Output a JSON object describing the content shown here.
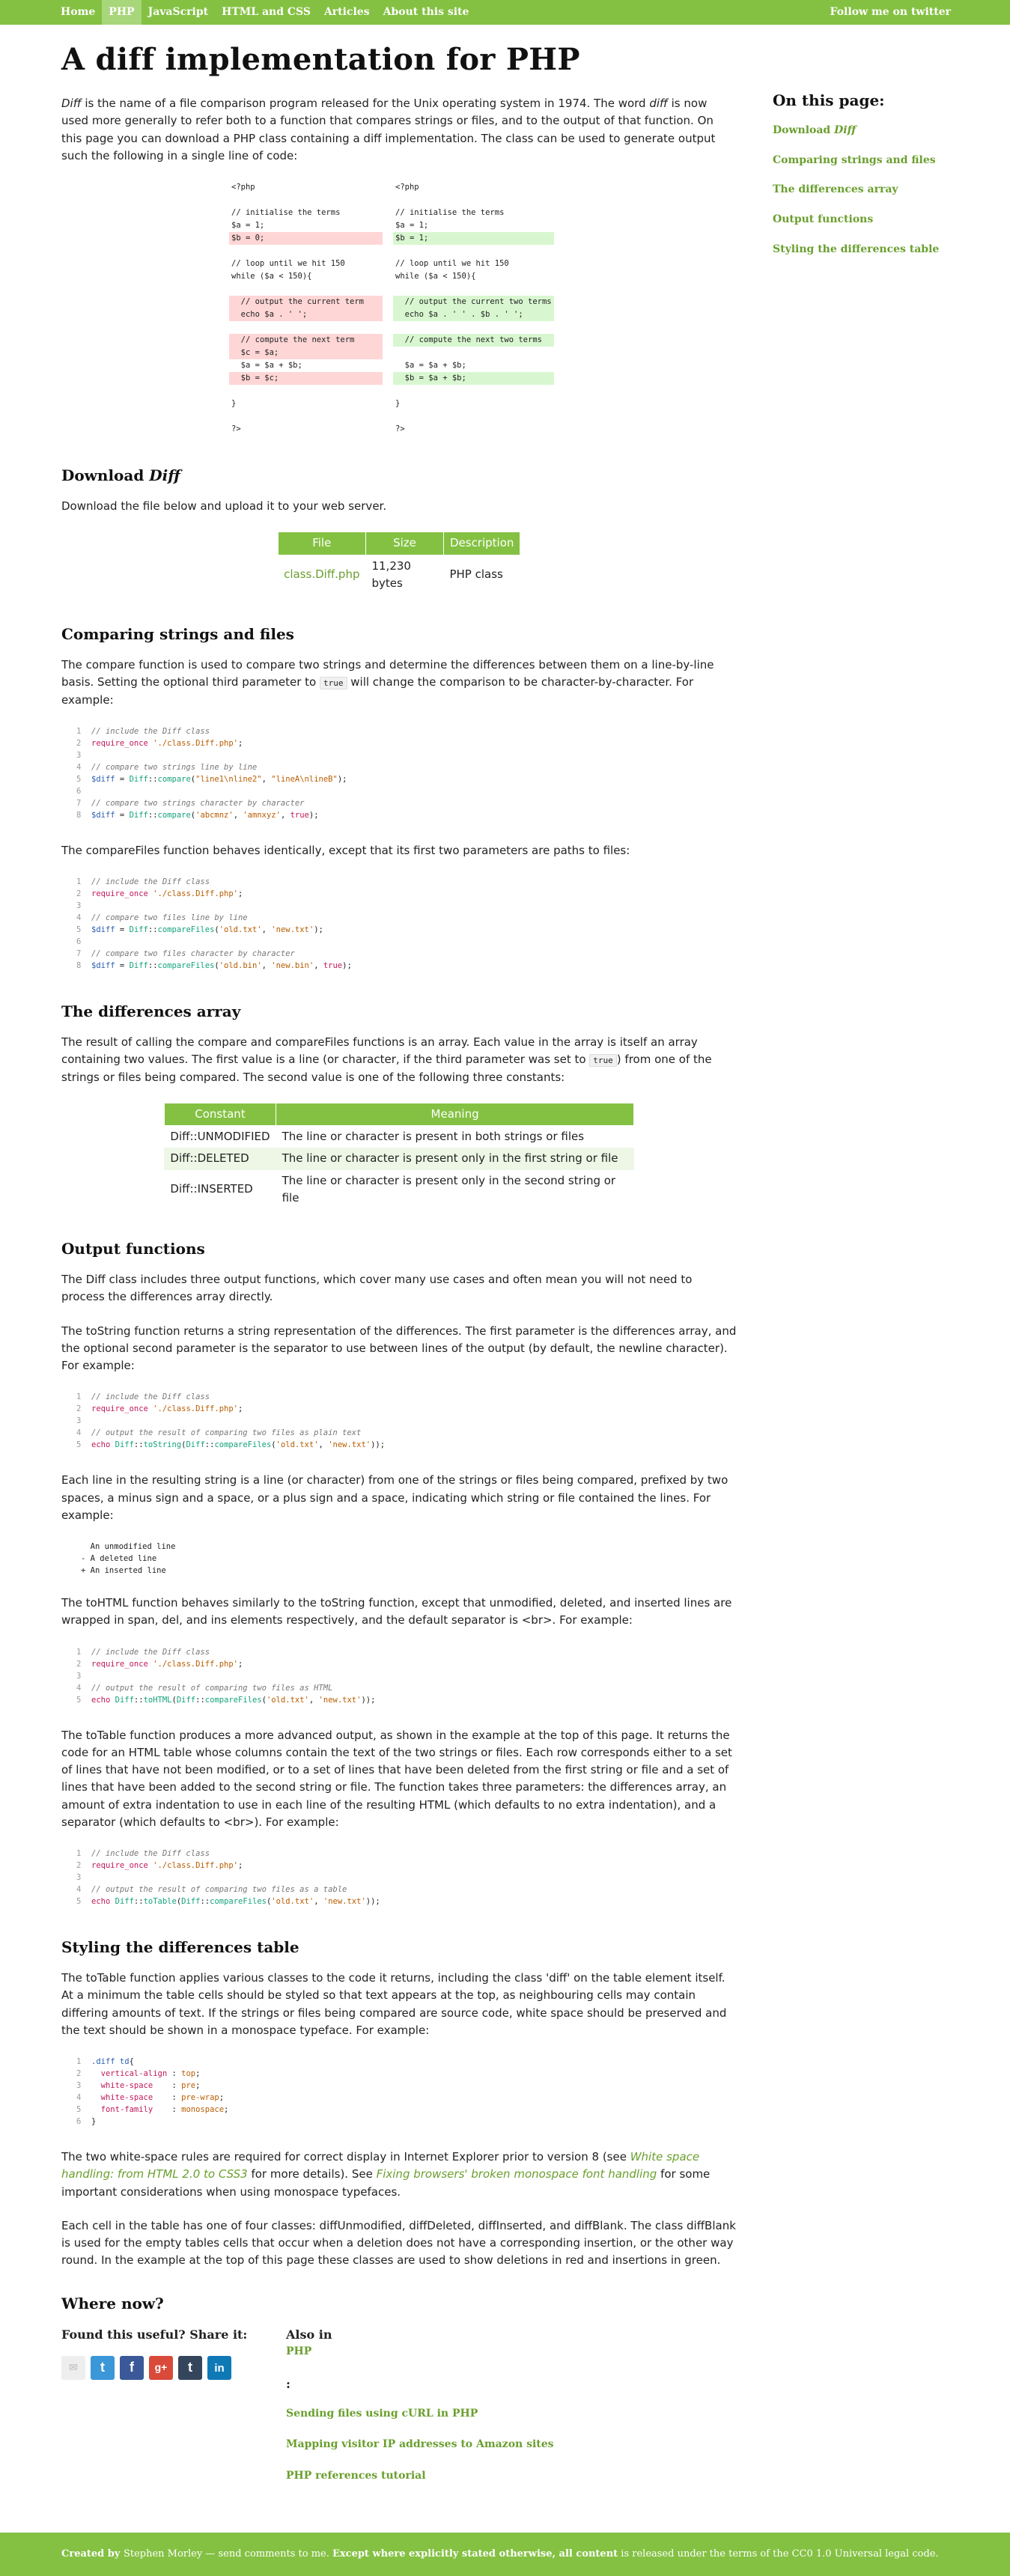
{
  "nav": {
    "items": [
      "Home",
      "PHP",
      "JavaScript",
      "HTML and CSS",
      "Articles",
      "About this site"
    ],
    "follow": "Follow me on twitter"
  },
  "title": "A diff implementation for PHP",
  "intro": {
    "em": "Diff",
    "t1": " is the name of a file comparison program released for the Unix operating system in 1974. The word ",
    "em2": "diff",
    "t2": " is now used more generally to refer both to a function that compares strings or files, and to the output of that function. On this page you can download a PHP class containing a diff implementation. The class can be used to generate output such the following in a single line of code:"
  },
  "diff_demo": [
    [
      "<?php",
      "",
      "<?php",
      ""
    ],
    [
      "",
      "",
      "",
      ""
    ],
    [
      "// initialise the terms",
      "",
      "// initialise the terms",
      ""
    ],
    [
      "$a = 1;",
      "",
      "$a = 1;",
      ""
    ],
    [
      "$b = 0;",
      "del",
      "$b = 1;",
      "ins"
    ],
    [
      "",
      "",
      "",
      ""
    ],
    [
      "// loop until we hit 150",
      "",
      "// loop until we hit 150",
      ""
    ],
    [
      "while ($a < 150){",
      "",
      "while ($a < 150){",
      ""
    ],
    [
      "",
      "",
      "",
      ""
    ],
    [
      "  // output the current term",
      "del",
      "  // output the current two terms",
      "ins"
    ],
    [
      "  echo $a . ' ';",
      "del",
      "  echo $a . ' ' . $b . ' ';",
      "ins"
    ],
    [
      "",
      "",
      "",
      ""
    ],
    [
      "  // compute the next term",
      "del",
      "  // compute the next two terms",
      "ins"
    ],
    [
      "  $c = $a;",
      "del",
      "",
      ""
    ],
    [
      "  $a = $a + $b;",
      "",
      "  $a = $a + $b;",
      ""
    ],
    [
      "  $b = $c;",
      "del",
      "  $b = $a + $b;",
      "ins"
    ],
    [
      "",
      "",
      "",
      ""
    ],
    [
      "}",
      "",
      "}",
      ""
    ],
    [
      "",
      "",
      "",
      ""
    ],
    [
      "?>",
      "",
      "?>",
      ""
    ]
  ],
  "toc": {
    "title": "On this page:",
    "items": [
      "Download ",
      "Comparing strings and files",
      "The differences array",
      "Output functions",
      "Styling the differences table"
    ],
    "first_em": "Diff"
  },
  "download": {
    "heading": "Download ",
    "heading_em": "Diff",
    "text": "Download the file below and upload it to your web server.",
    "headers": [
      "File",
      "Size",
      "Description"
    ],
    "row": [
      "class.Diff.php",
      "11,230 bytes",
      "PHP class"
    ]
  },
  "compare": {
    "heading": "Comparing strings and files",
    "p1a": "The compare function is used to compare two strings and determine the differences between them on a line-by-line basis. Setting the optional third parameter to ",
    "p1code": "true",
    "p1b": " will change the comparison to be character-by-character. For example:",
    "p2": "The compareFiles function behaves identically, except that its first two parameters are paths to files:"
  },
  "array": {
    "heading": "The differences array",
    "pa": "The result of calling the compare and compareFiles functions is an array. Each value in the array is itself an array containing two values. The first value is a line (or character, if the third parameter was set to ",
    "pcode": "true",
    "pb": ") from one of the strings or files being compared. The second value is one of the following three constants:",
    "headers": [
      "Constant",
      "Meaning"
    ],
    "rows": [
      [
        "Diff::UNMODIFIED",
        "The line or character is present in both strings or files"
      ],
      [
        "Diff::DELETED",
        "The line or character is present only in the first string or file"
      ],
      [
        "Diff::INSERTED",
        "The line or character is present only in the second string or file"
      ]
    ]
  },
  "output": {
    "heading": "Output functions",
    "p1": "The Diff class includes three output functions, which cover many use cases and often mean you will not need to process the differences array directly.",
    "p2": "The toString function returns a string representation of the differences. The first parameter is the differences array, and the optional second parameter is the separator to use between lines of the output (by default, the newline character). For example:",
    "p3": "Each line in the resulting string is a line (or character) from one of the strings or files being compared, prefixed by two spaces, a minus sign and a space, or a plus sign and a space, indicating which string or file contained the lines. For example:",
    "sample": "  An unmodified line\n- A deleted line\n+ An inserted line",
    "p4": "The toHTML function behaves similarly to the toString function, except that unmodified, deleted, and inserted lines are wrapped in span, del, and ins elements respectively, and the default separator is <br>. For example:",
    "p5": "The toTable function produces a more advanced output, as shown in the example at the top of this page. It returns the code for an HTML table whose columns contain the text of the two strings or files. Each row corresponds either to a set of lines that have not been modified, or to a set of lines that have been deleted from the first string or file and a set of lines that have been added to the second string or file. The function takes three parameters: the differences array, an amount of extra indentation to use in each line of the resulting HTML (which defaults to no extra indentation), and a separator (which defaults to <br>). For example:"
  },
  "styling": {
    "heading": "Styling the differences table",
    "p1": "The toTable function applies various classes to the code it returns, including the class 'diff' on the table element itself. At a minimum the table cells should be styled so that text appears at the top, as neighbouring cells may contain differing amounts of text. If the strings or files being compared are source code, white space should be preserved and the text should be shown in a monospace typeface. For example:",
    "p2a": "The two white-space rules are required for correct display in Internet Explorer prior to version 8 (see ",
    "p2link1": "White space handling: from HTML 2.0 to CSS3",
    "p2b": " for more details). See ",
    "p2link2": "Fixing browsers' broken monospace font handling",
    "p2c": " for some important considerations when using monospace typefaces.",
    "p3": "Each cell in the table has one of four classes: diffUnmodified, diffDeleted, diffInserted, and diffBlank. The class diffBlank is used for the empty tables cells that occur when a deletion does not have a corresponding insertion, or the other way round. In the example at the top of this page these classes are used to show deletions in red and insertions in green."
  },
  "where": {
    "heading": "Where now?",
    "share": "Found this useful? Share it:",
    "also_a": "Also in ",
    "also_b": "PHP",
    "also_c": ":",
    "links": [
      "Sending files using cURL in PHP",
      "Mapping visitor IP addresses to Amazon sites",
      "PHP references tutorial"
    ]
  },
  "footer": {
    "a": "Created by ",
    "b": "Stephen Morley",
    "c": " — send comments to me. ",
    "d": "Except where explicitly stated otherwise, all content",
    "e": " is released under the terms of the ",
    "f": "CC0 1.0 Universal legal code."
  },
  "colors": {
    "accent": "#84c142",
    "link": "#6a9f2e",
    "deleted": "#ffd6d6",
    "inserted": "#d8f7d0"
  }
}
